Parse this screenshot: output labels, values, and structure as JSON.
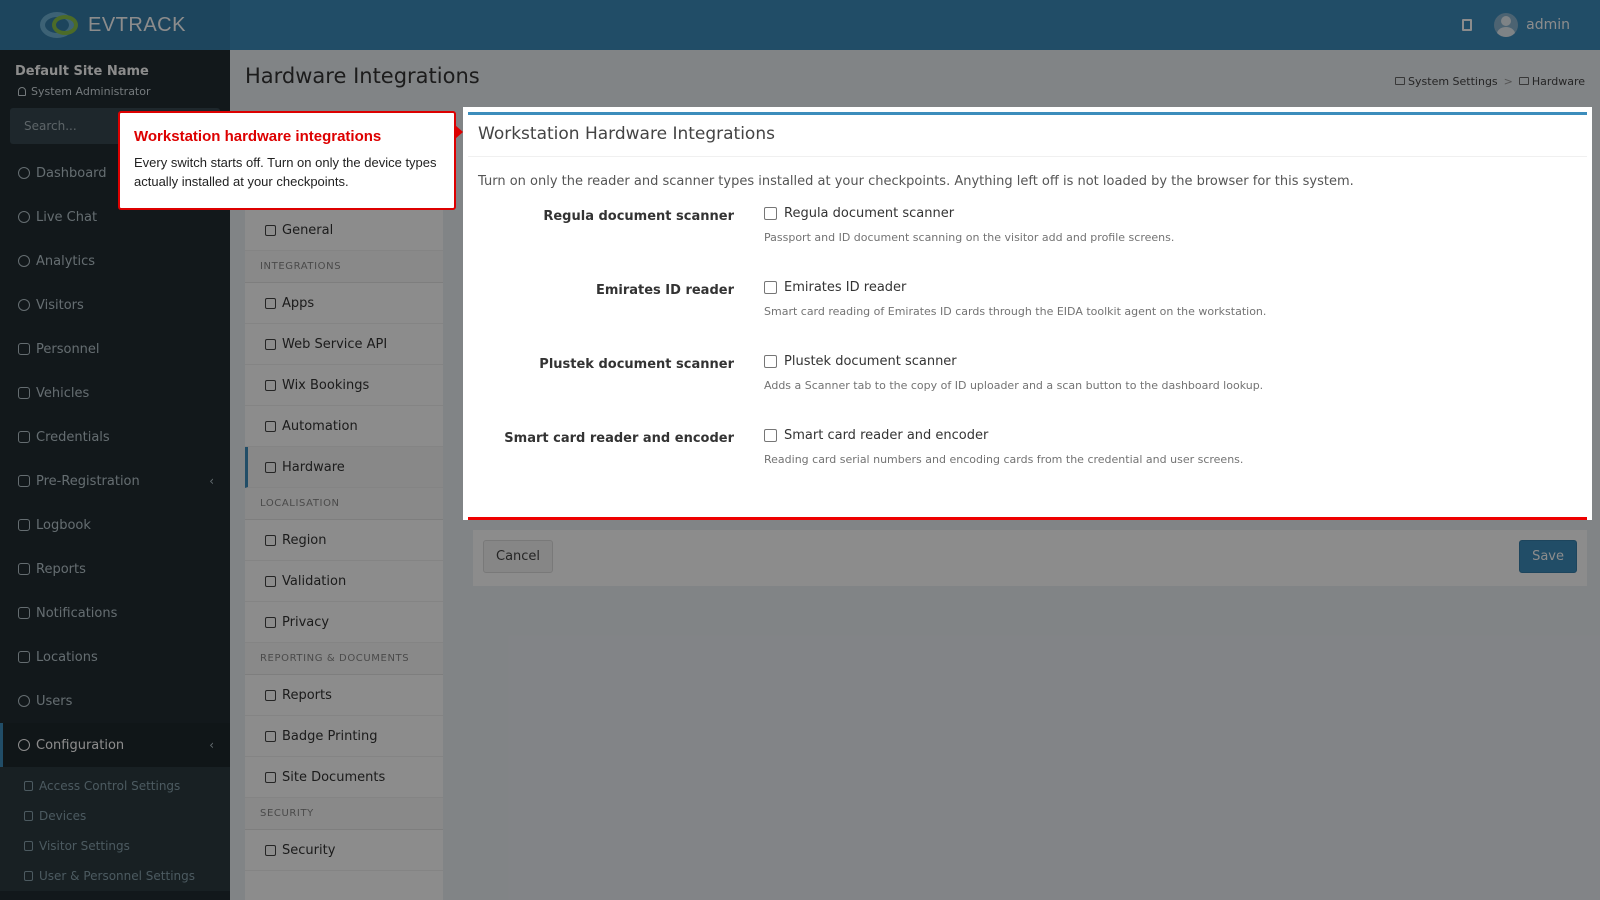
{
  "app": {
    "logo_text": "EVTRACK",
    "brand_color": "#3c8dbc"
  },
  "header": {
    "user_name": "admin",
    "book_icon": "book-icon",
    "avatar_icon": "user-avatar"
  },
  "sidebar": {
    "site_name": "Default Site Name",
    "site_role": "System Administrator",
    "search_placeholder": "Search...",
    "items": [
      {
        "label": "Dashboard",
        "icon": "gauge-icon"
      },
      {
        "label": "Live Chat",
        "icon": "headset-icon"
      },
      {
        "label": "Analytics",
        "icon": "target-icon"
      },
      {
        "label": "Visitors",
        "icon": "eye-icon"
      },
      {
        "label": "Personnel",
        "icon": "user-gear-icon"
      },
      {
        "label": "Vehicles",
        "icon": "car-icon"
      },
      {
        "label": "Credentials",
        "icon": "id-badge-icon"
      },
      {
        "label": "Pre-Registration",
        "icon": "arrows-icon"
      },
      {
        "label": "Logbook",
        "icon": "book-icon"
      },
      {
        "label": "Reports",
        "icon": "chart-icon"
      },
      {
        "label": "Notifications",
        "icon": "message-icon"
      },
      {
        "label": "Locations",
        "icon": "building-icon"
      },
      {
        "label": "Users",
        "icon": "users-icon"
      },
      {
        "label": "Configuration",
        "icon": "gear-icon"
      }
    ],
    "sub_items": [
      {
        "label": "Access Control Settings",
        "icon": "lock-icon"
      },
      {
        "label": "Devices",
        "icon": "gear-icon"
      },
      {
        "label": "Visitor Settings",
        "icon": "eye-icon"
      },
      {
        "label": "User & Personnel Settings",
        "icon": "users-icon"
      }
    ]
  },
  "page": {
    "title": "Hardware Integrations",
    "breadcrumb": [
      "System Settings",
      "Hardware"
    ]
  },
  "settings_nav": {
    "general": "General",
    "groups": [
      {
        "title": "INTEGRATIONS",
        "items": [
          "Apps",
          "Web Service API",
          "Wix Bookings",
          "Automation",
          "Hardware"
        ]
      },
      {
        "title": "LOCALISATION",
        "items": [
          "Region",
          "Validation",
          "Privacy"
        ]
      },
      {
        "title": "REPORTING & DOCUMENTS",
        "items": [
          "Reports",
          "Badge Printing",
          "Site Documents"
        ]
      },
      {
        "title": "SECURITY",
        "items": [
          "Security"
        ]
      }
    ],
    "active": "Hardware"
  },
  "card": {
    "title": "Workstation Hardware Integrations",
    "intro": "Turn on only the reader and scanner types installed at your checkpoints. Anything left off is not loaded by the browser for this system.",
    "rows": [
      {
        "label": "Regula document scanner",
        "check_label": "Regula document scanner",
        "checked": false,
        "help": "Passport and ID document scanning on the visitor add and profile screens."
      },
      {
        "label": "Emirates ID reader",
        "check_label": "Emirates ID reader",
        "checked": false,
        "help": "Smart card reading of Emirates ID cards through the EIDA toolkit agent on the workstation."
      },
      {
        "label": "Plustek document scanner",
        "check_label": "Plustek document scanner",
        "checked": false,
        "help": "Adds a Scanner tab to the copy of ID uploader and a scan button to the dashboard lookup."
      },
      {
        "label": "Smart card reader and encoder",
        "check_label": "Smart card reader and encoder",
        "checked": false,
        "help": "Reading card serial numbers and encoding cards from the credential and user screens."
      }
    ]
  },
  "actions": {
    "cancel": "Cancel",
    "save": "Save"
  },
  "callout": {
    "title": "Workstation hardware integrations",
    "text": "Every switch starts off. Turn on only the device types actually installed at your checkpoints.",
    "border_color": "#dd0000"
  }
}
